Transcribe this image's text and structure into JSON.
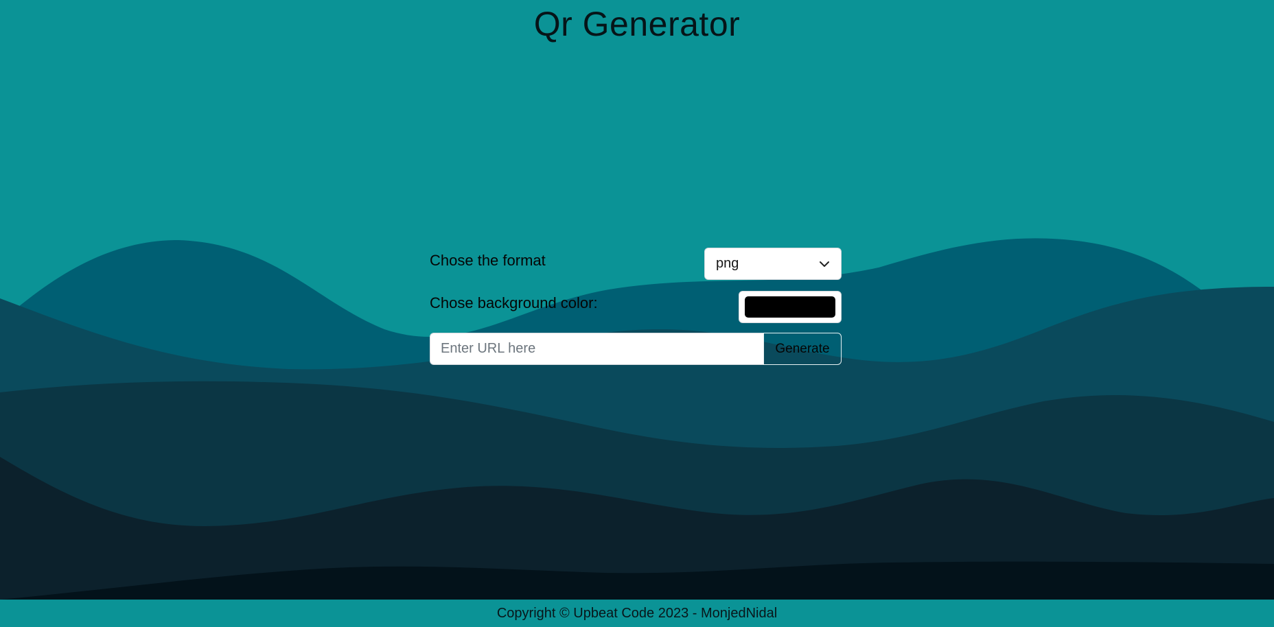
{
  "header": {
    "title": "Qr Generator"
  },
  "form": {
    "format_label": "Chose the format",
    "format_value": "png",
    "background_label": "Chose background color:",
    "background_color": "#000000",
    "url_placeholder": "Enter URL here",
    "url_value": "",
    "generate_label": "Generate"
  },
  "footer": {
    "text": "Copyright © Upbeat Code 2023 - MonjedNidal"
  },
  "theme": {
    "background": "#0b9396",
    "wave_colors": [
      "#005f73",
      "#0a4a5c",
      "#0b3644",
      "#0c212c",
      "#03121a"
    ]
  },
  "icons": {
    "select_arrow": "chevron-down-icon"
  }
}
